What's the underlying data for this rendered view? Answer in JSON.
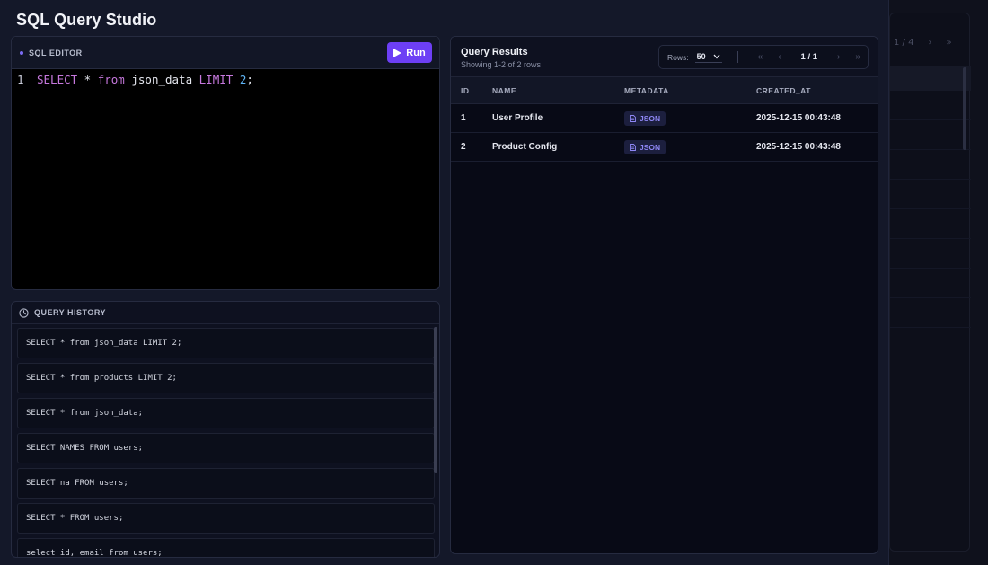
{
  "app": {
    "title": "SQL Query Studio"
  },
  "editor": {
    "label": "SQL EDITOR",
    "run_label": "Run",
    "line_number": "1",
    "tokens": {
      "select": "SELECT",
      "star": " * ",
      "from": "from",
      "table": " json_data ",
      "limit": "LIMIT",
      "space": " ",
      "count": "2",
      "semi": ";"
    }
  },
  "history": {
    "label": "QUERY HISTORY",
    "items": [
      "SELECT * from json_data LIMIT 2;",
      "SELECT * from products LIMIT 2;",
      "SELECT * from json_data;",
      "SELECT NAMES FROM users;",
      "SELECT na FROM users;",
      "SELECT * FROM users;",
      "select id, email from users;"
    ]
  },
  "results": {
    "title": "Query Results",
    "subtitle": "Showing 1-2 of 2 rows",
    "pager": {
      "rows_label": "Rows:",
      "rows_value": "50",
      "first": "«",
      "prev": "‹",
      "page_text": "1 / 1",
      "next": "›",
      "last": "»"
    },
    "columns": [
      "ID",
      "NAME",
      "METADATA",
      "CREATED_AT"
    ],
    "rows": [
      {
        "id": "1",
        "name": "User Profile",
        "metadata": "JSON",
        "created_at": "2025-12-15 00:43:48"
      },
      {
        "id": "2",
        "name": "Product Config",
        "metadata": "JSON",
        "created_at": "2025-12-15 00:43:48"
      }
    ]
  },
  "background": {
    "pager_text": "1 / 4",
    "next": "›",
    "last": "»"
  },
  "colors": {
    "accent": "#6d3ff5",
    "keyword": "#c678dd",
    "number": "#5fb4f5",
    "badge_text": "#8f87f5"
  },
  "icons": {
    "run": "play-icon",
    "history": "clock-icon",
    "badge": "file-icon",
    "rows": "chevron-down-icon"
  }
}
